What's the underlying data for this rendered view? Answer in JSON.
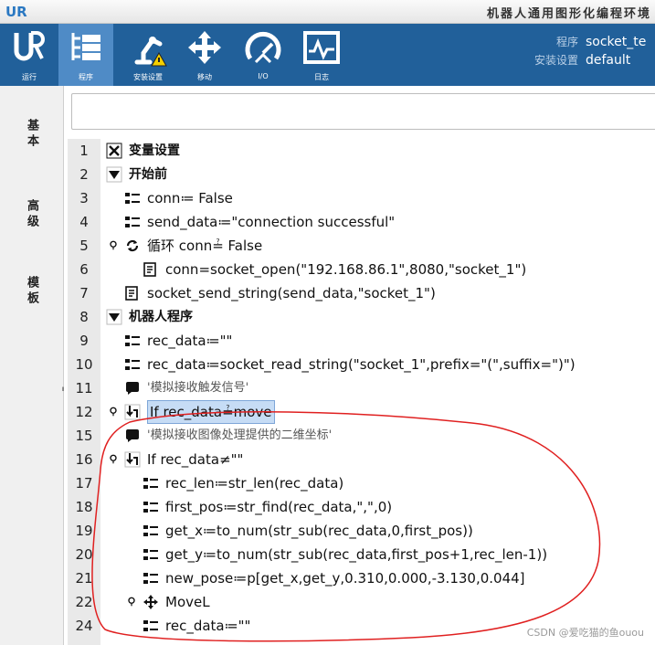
{
  "window": {
    "logo": "UR",
    "title": "机器人通用图形化编程环境"
  },
  "toolbar": {
    "buttons": [
      {
        "label": "运行",
        "icon": "ur-logo-icon"
      },
      {
        "label": "程序",
        "icon": "program-tree-icon",
        "active": true
      },
      {
        "label": "安装设置",
        "icon": "robot-arm-warning-icon"
      },
      {
        "label": "移动",
        "icon": "move-arrows-icon"
      },
      {
        "label": "I/O",
        "icon": "io-gauge-icon"
      },
      {
        "label": "日志",
        "icon": "log-chart-icon"
      }
    ],
    "program_key": "程序",
    "program_value": "socket_te",
    "install_key": "安装设置",
    "install_value": "default"
  },
  "sidebar": {
    "tabs": [
      "基本",
      "高级",
      "模板"
    ]
  },
  "program": {
    "lines": [
      {
        "num": "1",
        "text": "变量设置",
        "icon": "variables-icon",
        "style": "b",
        "indent": 0
      },
      {
        "num": "2",
        "text": "开始前",
        "icon": "expand-triangle-icon",
        "style": "b",
        "indent": 0
      },
      {
        "num": "3",
        "text": "conn≔ False",
        "icon": "assignment-icon",
        "indent": 1
      },
      {
        "num": "4",
        "text": "send_data≔\"connection successful\"",
        "icon": "assignment-icon",
        "indent": 1
      },
      {
        "num": "5",
        "text": "循环 conn≟ False",
        "icon": "loop-icon",
        "indent": 1,
        "dot": true
      },
      {
        "num": "6",
        "text": "conn=socket_open(\"192.168.86.1\",8080,\"socket_1\")",
        "icon": "script-icon",
        "indent": 2
      },
      {
        "num": "7",
        "text": "socket_send_string(send_data,\"socket_1\")",
        "icon": "script-icon",
        "indent": 1
      },
      {
        "num": "8",
        "text": "机器人程序",
        "icon": "expand-triangle-icon",
        "style": "b",
        "indent": 0
      },
      {
        "num": "9",
        "text": "rec_data≔\"\"",
        "icon": "assignment-icon",
        "indent": 1
      },
      {
        "num": "10",
        "text": "rec_data≔socket_read_string(\"socket_1\",prefix=\"(\",suffix=\")\")",
        "icon": "assignment-icon",
        "indent": 1
      },
      {
        "num": "11",
        "text": "'模拟接收触发信号'",
        "icon": "comment-icon",
        "style": "cm",
        "indent": 1
      },
      {
        "num": "12",
        "text": "If rec_data≟move",
        "icon": "if-icon",
        "style": "sel",
        "indent": 1,
        "dot": true
      },
      {
        "num": "15",
        "text": "'模拟接收图像处理提供的二维坐标'",
        "icon": "comment-icon",
        "style": "cm",
        "indent": 1
      },
      {
        "num": "16",
        "text": "If rec_data≠\"\"",
        "icon": "if-icon",
        "indent": 1,
        "dot": true
      },
      {
        "num": "17",
        "text": "rec_len≔str_len(rec_data)",
        "icon": "assignment-icon",
        "indent": 2
      },
      {
        "num": "18",
        "text": "first_pos≔str_find(rec_data,\",\",0)",
        "icon": "assignment-icon",
        "indent": 2
      },
      {
        "num": "19",
        "text": "get_x≔to_num(str_sub(rec_data,0,first_pos))",
        "icon": "assignment-icon",
        "indent": 2
      },
      {
        "num": "20",
        "text": "get_y≔to_num(str_sub(rec_data,first_pos+1,rec_len-1))",
        "icon": "assignment-icon",
        "indent": 2
      },
      {
        "num": "21",
        "text": "new_pose≔p[get_x,get_y,0.310,0.000,-3.130,0.044]",
        "icon": "assignment-icon",
        "indent": 2
      },
      {
        "num": "22",
        "text": "MoveL",
        "icon": "move-cross-icon",
        "indent": 2,
        "dot": true
      },
      {
        "num": "24",
        "text": "rec_data≔\"\"",
        "icon": "assignment-icon",
        "indent": 2
      }
    ]
  },
  "watermark": "CSDN @爱吃猫的鱼ouou",
  "colors": {
    "toolbar": "#21609a",
    "toolbar_active": "#4f8bc6",
    "selection": "#c6dcf5",
    "annotation": "#e02020"
  }
}
